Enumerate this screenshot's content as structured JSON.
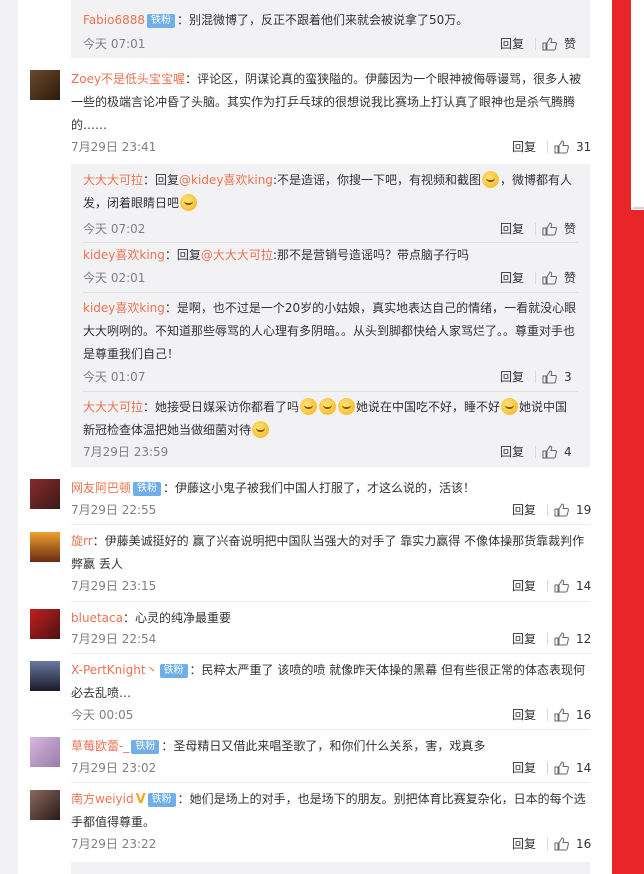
{
  "ui": {
    "reply_label": "回复",
    "zan_label": "赞",
    "badge_label": "铁粉"
  },
  "colors": {
    "accent_name": "#eb7350",
    "badge": "#6faee8",
    "page_red": "#e8262a"
  },
  "top_reply": {
    "name": "Fabio6888",
    "text": "：别混微博了，反正不跟着他们来就会被说拿了50万。",
    "time": "今天 07:01"
  },
  "comments": [
    {
      "name": "Zoey不是低头宝宝喔",
      "text": "：评论区，阴谋论真的蛮狭隘的。伊藤因为一个眼神被侮辱谩骂，很多人被一些的极端言论冲昏了头脑。其实作为打乒乓球的很想说我比赛场上打认真了眼神也是杀气腾腾的……",
      "time": "7月29日 23:41",
      "likes": "31",
      "replies": [
        {
          "name": "大大大可拉",
          "pre": "：回复",
          "at": "@kidey喜欢king",
          "text": ":不是造谣，你搜一下吧，有视频和截图",
          "text2": "，微博都有人发，闭着眼睛日吧",
          "time": "今天 07:02"
        },
        {
          "name": "kidey喜欢king",
          "pre": "：回复",
          "at": "@大大大可拉",
          "text": ":那不是营销号造谣吗？带点脑子行吗",
          "time": "今天 02:01"
        },
        {
          "name": "kidey喜欢king",
          "text": "：是啊，也不过是一个20岁的小姑娘，真实地表达自己的情绪，一看就没心眼大大咧咧的。不知道那些辱骂的人心理有多阴暗。。从头到脚都快给人家骂烂了。。尊重对手也是尊重我们自己！",
          "time": "今天 01:07",
          "likes": "3"
        },
        {
          "name": "大大大可拉",
          "text": "：她接受日媒采访你都看了吗",
          "text2": "她说在中国吃不好，睡不好",
          "text3": "她说中国新冠检查体温把她当做细菌对待",
          "time": "7月29日 23:59",
          "likes": "4"
        }
      ]
    },
    {
      "name": "网友阿巴顿",
      "badge": true,
      "text": "：伊藤这小鬼子被我们中国人打服了，才这么说的，活该！",
      "time": "7月29日 22:55",
      "likes": "19"
    },
    {
      "name": "旋rr",
      "text": "：伊藤美诚挺好的  赢了兴奋说明把中国队当强大的对手了  靠实力赢得  不像体操那货靠裁判作弊赢  丢人",
      "time": "7月29日 23:15",
      "likes": "14"
    },
    {
      "name": "bluetaca",
      "text": "：心灵的纯净最重要",
      "time": "7月29日 22:54",
      "likes": "12"
    },
    {
      "name": "X-PertKnight丶",
      "badge": true,
      "text": "：民粹太严重了  该喷的喷  就像昨天体操的黑幕  但有些很正常的体态表现何必去乱喷…",
      "time": "今天 00:05",
      "likes": "16"
    },
    {
      "name": "草莓欧蕾-_",
      "badge": true,
      "text": "：圣母精日又借此来唱圣歌了，和你们什么关系，害，戏真多",
      "time": "7月29日 23:02",
      "likes": "14"
    },
    {
      "name": "南方weiyid",
      "vip": "V",
      "badge": true,
      "text": "：她们是场上的对手，也是场下的朋友。别把体育比赛复杂化，日本的每个选手都值得尊重。",
      "time": "7月29日 23:22",
      "likes": "16"
    }
  ]
}
